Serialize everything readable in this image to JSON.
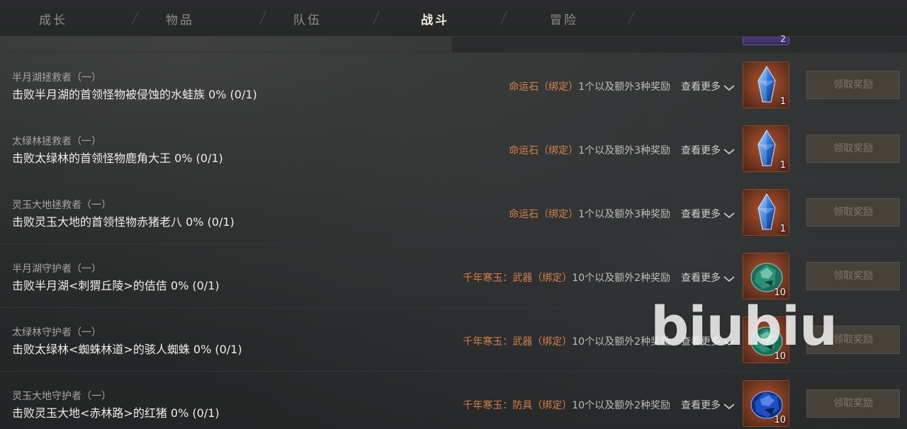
{
  "tabs": [
    {
      "label": "成长",
      "active": false
    },
    {
      "label": "物品",
      "active": false
    },
    {
      "label": "队伍",
      "active": false
    },
    {
      "label": "战斗",
      "active": true
    },
    {
      "label": "冒险",
      "active": false
    }
  ],
  "prev_row": {
    "item_qty": "2"
  },
  "more_label": "查看更多",
  "claim_label": "领取奖励",
  "rows": [
    {
      "title": "半月湖拯救者（一）",
      "desc": "击败半月湖的首领怪物被侵蚀的水蛙族 0% (0/1)",
      "reward_name": "命运石（绑定）",
      "reward_count": "1个以及额外3种奖励",
      "item_type": "fate-stone",
      "item_qty": "1"
    },
    {
      "title": "太绿林拯救者（一）",
      "desc": "击败太绿林的首领怪物鹿角大王 0% (0/1)",
      "reward_name": "命运石（绑定）",
      "reward_count": "1个以及额外3种奖励",
      "item_type": "fate-stone",
      "item_qty": "1"
    },
    {
      "title": "灵玉大地拯救者（一）",
      "desc": "击败灵玉大地的首领怪物赤猪老八 0% (0/1)",
      "reward_name": "命运石（绑定）",
      "reward_count": "1个以及额外3种奖励",
      "item_type": "fate-stone",
      "item_qty": "1"
    },
    {
      "title": "半月湖守护者（一）",
      "desc": "击败半月湖<刺猬丘陵>的佶佶 0% (0/1)",
      "reward_name": "千年寒玉：武器（绑定）",
      "reward_count": "10个以及额外2种奖励",
      "item_type": "jade-weapon",
      "item_qty": "10"
    },
    {
      "title": "太绿林守护者（一）",
      "desc": "击败太绿林<蜘蛛林道>的骇人蜘蛛 0% (0/1)",
      "reward_name": "千年寒玉：武器（绑定）",
      "reward_count": "10个以及额外2种奖励",
      "item_type": "jade-weapon",
      "item_qty": "10"
    },
    {
      "title": "灵玉大地守护者（一）",
      "desc": "击败灵玉大地<赤林路>的红猪 0% (0/1)",
      "reward_name": "千年寒玉：防具（绑定）",
      "reward_count": "10个以及额外2种奖励",
      "item_type": "jade-armor",
      "item_qty": "10"
    }
  ],
  "watermark": "biubiu",
  "colors": {
    "reward": "#d6804a",
    "active_tab": "#f1ede2",
    "button_bg": "#46423a"
  }
}
